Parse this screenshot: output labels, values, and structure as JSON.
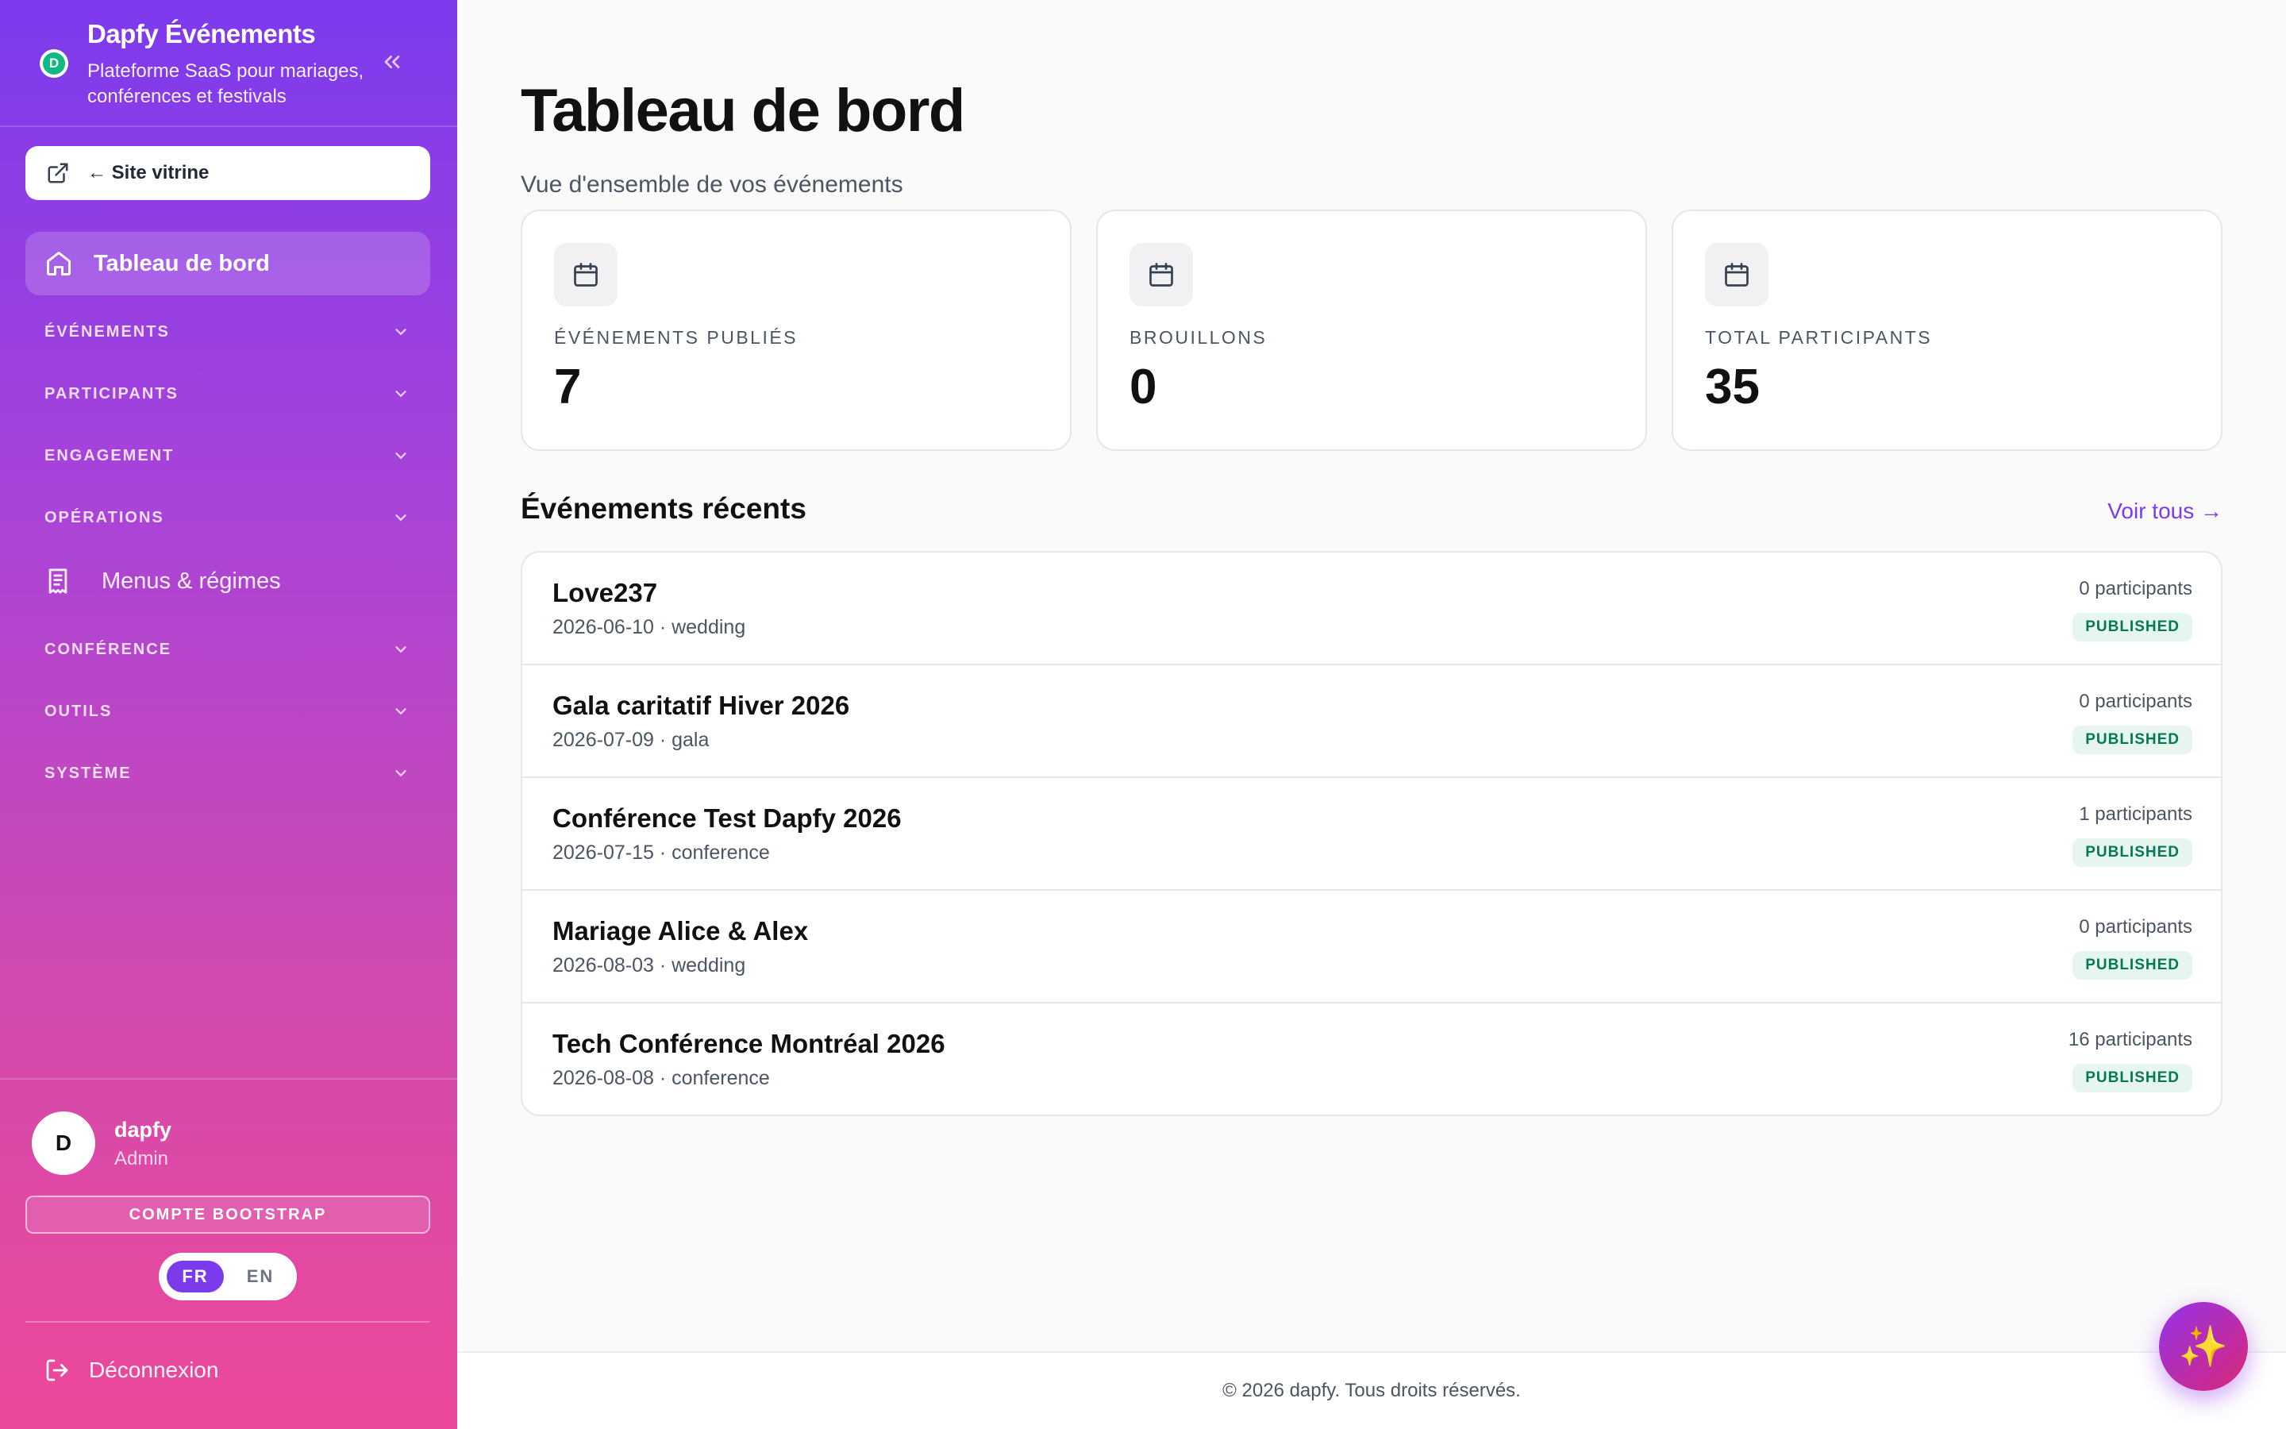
{
  "brand": {
    "logo_letter": "D",
    "title": "Dapfy Événements",
    "subtitle": "Plateforme SaaS pour mariages, conférences et festivals"
  },
  "sidebar": {
    "vitrine_label": "← Site vitrine",
    "active_item": "Tableau de bord",
    "sections": [
      {
        "label": "ÉVÉNEMENTS"
      },
      {
        "label": "PARTICIPANTS"
      },
      {
        "label": "ENGAGEMENT"
      },
      {
        "label": "OPÉRATIONS"
      },
      {
        "label": "CONFÉRENCE"
      },
      {
        "label": "OUTILS"
      },
      {
        "label": "SYSTÈME"
      }
    ],
    "menus_item": "Menus & régimes"
  },
  "user": {
    "initial": "D",
    "name": "dapfy",
    "role": "Admin",
    "bootstrap_label": "COMPTE BOOTSTRAP",
    "langs": [
      "FR",
      "EN"
    ],
    "active_lang": "FR",
    "logout_label": "Déconnexion"
  },
  "page": {
    "title": "Tableau de bord",
    "subtitle": "Vue d'ensemble de vos événements"
  },
  "stats": [
    {
      "label": "ÉVÉNEMENTS PUBLIÉS",
      "value": "7"
    },
    {
      "label": "BROUILLONS",
      "value": "0"
    },
    {
      "label": "TOTAL PARTICIPANTS",
      "value": "35"
    }
  ],
  "recent": {
    "title": "Événements récents",
    "see_all": "Voir tous →",
    "events": [
      {
        "name": "Love237",
        "meta": "2026-06-10 · wedding",
        "participants": "0 participants",
        "status": "PUBLISHED"
      },
      {
        "name": "Gala caritatif Hiver 2026",
        "meta": "2026-07-09 · gala",
        "participants": "0 participants",
        "status": "PUBLISHED"
      },
      {
        "name": "Conférence Test Dapfy 2026",
        "meta": "2026-07-15 · conference",
        "participants": "1 participants",
        "status": "PUBLISHED"
      },
      {
        "name": "Mariage Alice & Alex",
        "meta": "2026-08-03 · wedding",
        "participants": "0 participants",
        "status": "PUBLISHED"
      },
      {
        "name": "Tech Conférence Montréal 2026",
        "meta": "2026-08-08 · conference",
        "participants": "16 participants",
        "status": "PUBLISHED"
      }
    ]
  },
  "footer": {
    "text": "© 2026 dapfy. Tous droits réservés."
  },
  "fab": {
    "glyph": "✨"
  },
  "colors": {
    "accent": "#7c3aed",
    "badge_bg": "#e6f6ef",
    "badge_text": "#047857"
  }
}
